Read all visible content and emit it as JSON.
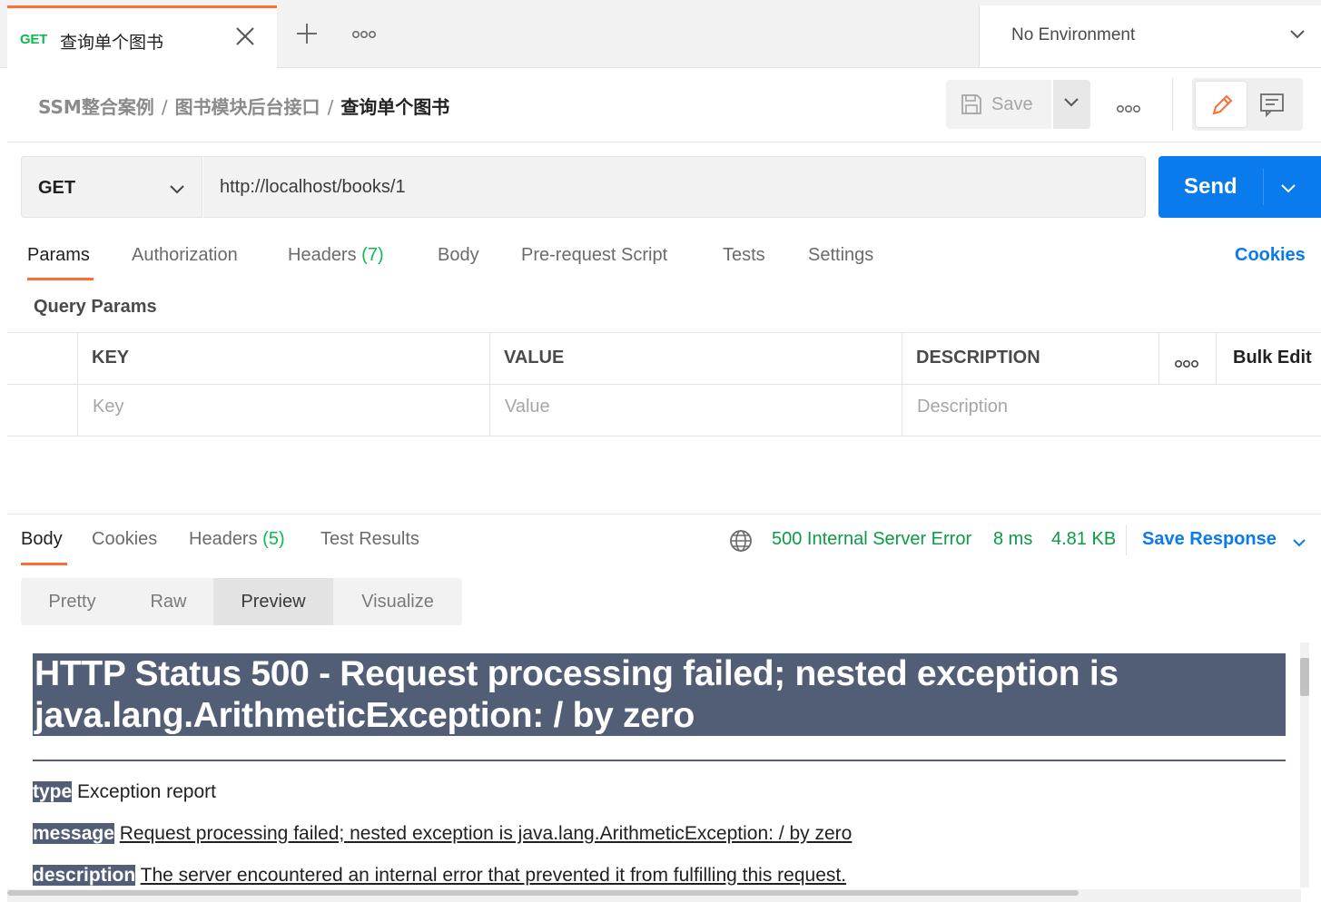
{
  "tab": {
    "method": "GET",
    "name": "查询单个图书"
  },
  "environment": {
    "label": "No Environment"
  },
  "breadcrumb": {
    "collection": "SSM整合案例",
    "folder": "图书模块后台接口",
    "current": "查询单个图书",
    "separator": "/"
  },
  "toolbar": {
    "save_label": "Save"
  },
  "request": {
    "method": "GET",
    "url": "http://localhost/books/1",
    "send_label": "Send"
  },
  "request_tabs": {
    "params": "Params",
    "authorization": "Authorization",
    "headers": "Headers",
    "headers_count": "(7)",
    "body": "Body",
    "prerequest": "Pre-request Script",
    "tests": "Tests",
    "settings": "Settings",
    "cookies": "Cookies"
  },
  "query_params": {
    "title": "Query Params",
    "headers": {
      "key": "KEY",
      "value": "VALUE",
      "description": "DESCRIPTION",
      "bulk_edit": "Bulk Edit"
    },
    "placeholders": {
      "key": "Key",
      "value": "Value",
      "description": "Description"
    }
  },
  "response_tabs": {
    "body": "Body",
    "cookies": "Cookies",
    "headers": "Headers",
    "headers_count": "(5)",
    "test_results": "Test Results"
  },
  "response_meta": {
    "status": "500 Internal Server Error",
    "time": "8 ms",
    "size": "4.81 KB",
    "save_response": "Save Response"
  },
  "view_modes": {
    "pretty": "Pretty",
    "raw": "Raw",
    "preview": "Preview",
    "visualize": "Visualize"
  },
  "preview": {
    "title_line1": "HTTP Status 500 - Request processing failed; nested exception is",
    "title_line2": "java.lang.ArithmeticException: / by zero",
    "type_label": "type",
    "type_value": "Exception report",
    "message_label": "message",
    "message_value": "Request processing failed; nested exception is java.lang.ArithmeticException: / by zero",
    "description_label": "description",
    "description_value": "The server encountered an internal error that prevented it from fulfilling this request."
  },
  "colors": {
    "accent": "#ff6c37",
    "send": "#097bed",
    "get_method": "#0cbb52",
    "status_ok_text": "#0b9b45",
    "tomcat_header": "#525d76"
  }
}
